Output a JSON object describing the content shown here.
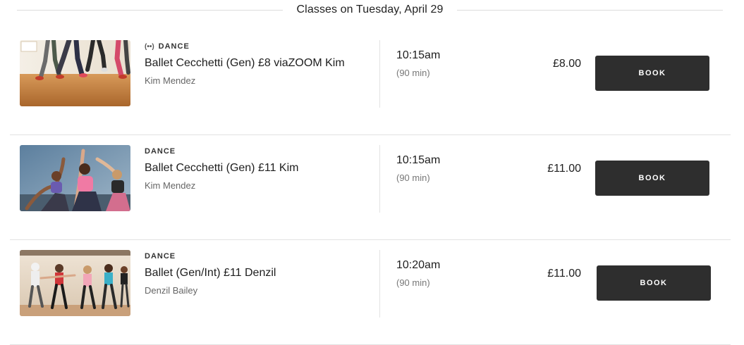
{
  "header": {
    "title": "Classes on Tuesday, April 29"
  },
  "classes": [
    {
      "live_icon": "(••)",
      "category": "DANCE",
      "name": "Ballet Cecchetti (Gen) £8 viaZOOM Kim",
      "instructor": "Kim Mendez",
      "time": "10:15am",
      "duration": "(90 min)",
      "price": "£8.00",
      "book_label": "BOOK",
      "thumbnail": "dance-studio-legs-photo"
    },
    {
      "category": "DANCE",
      "name": "Ballet Cecchetti (Gen) £11 Kim",
      "instructor": "Kim Mendez",
      "time": "10:15am",
      "duration": "(90 min)",
      "price": "£11.00",
      "book_label": "BOOK",
      "thumbnail": "stretching-class-photo"
    },
    {
      "category": "DANCE",
      "name": "Ballet (Gen/Int) £11 Denzil",
      "instructor": "Denzil Bailey",
      "time": "10:20am",
      "duration": "(90 min)",
      "price": "£11.00",
      "book_label": "BOOK",
      "thumbnail": "dance-class-group-photo"
    }
  ],
  "colors": {
    "button_bg": "#2e2e2e",
    "button_text": "#ffffff",
    "divider": "#e2e2e2"
  }
}
